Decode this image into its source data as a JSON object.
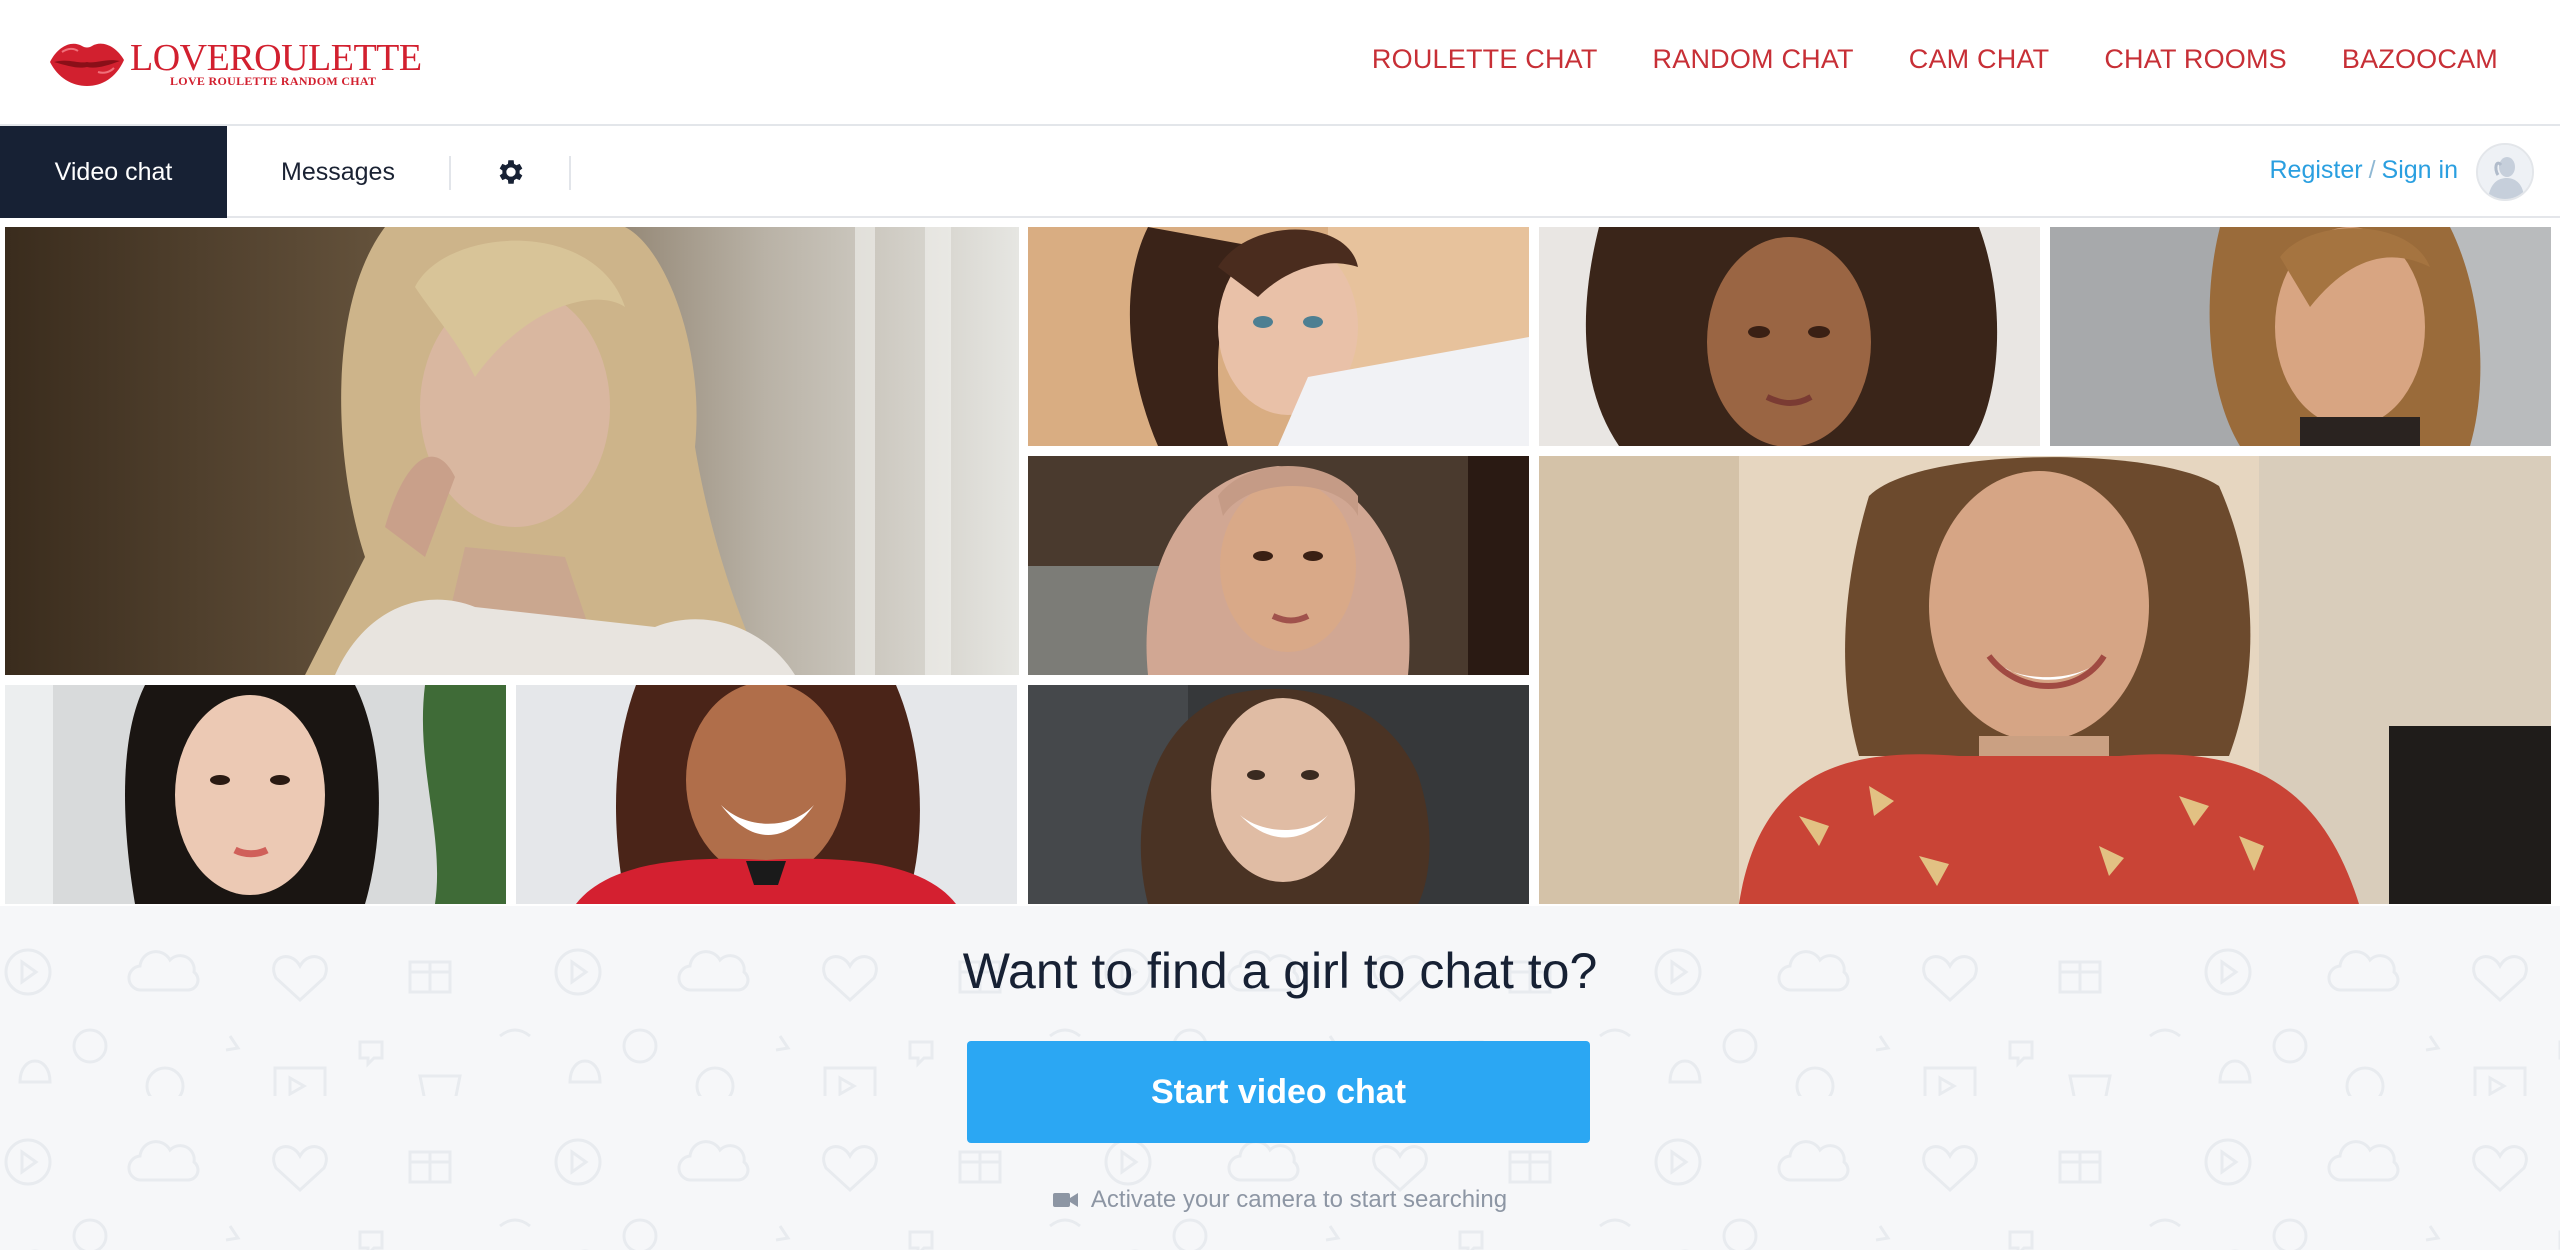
{
  "brand": {
    "name": "LOVEROULETTE",
    "tagline": "LOVE ROULETTE RANDOM CHAT",
    "color": "#d2202f"
  },
  "top_nav": {
    "items": [
      {
        "label": "ROULETTE CHAT"
      },
      {
        "label": "RANDOM CHAT"
      },
      {
        "label": "CAM CHAT"
      },
      {
        "label": "CHAT ROOMS"
      },
      {
        "label": "BAZOOCAM"
      }
    ]
  },
  "subbar": {
    "tab_video": "Video chat",
    "tab_messages": "Messages",
    "settings_icon": "gear-icon",
    "register": "Register",
    "separator": "/",
    "sign_in": "Sign in",
    "active_tab_color": "#172134",
    "link_color": "#2a9fe0"
  },
  "main": {
    "headline": "Want to find a girl to chat to?",
    "cta_label": "Start video chat",
    "cta_color": "#2ba7f3",
    "hint": "Activate your camera to start searching",
    "hint_icon": "camera-icon"
  }
}
